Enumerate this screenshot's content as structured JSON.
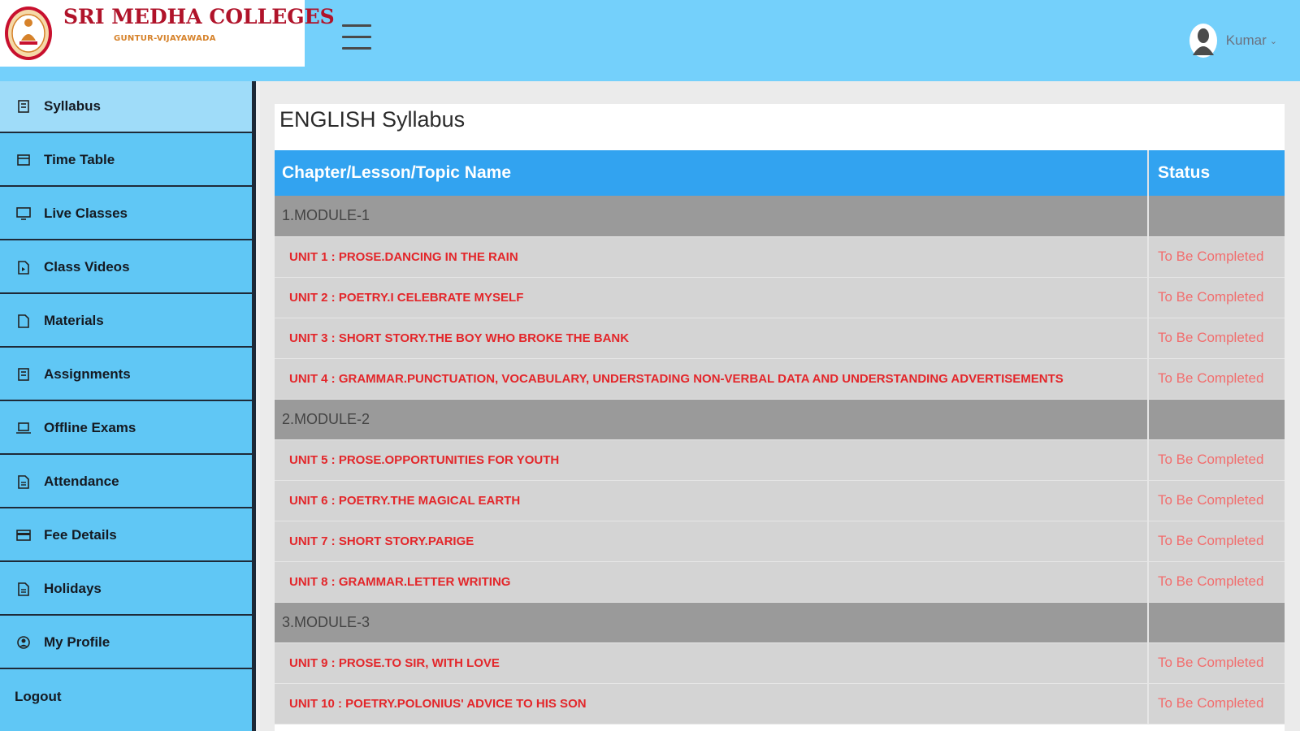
{
  "header": {
    "logo_title": "SRI MEDHA COLLEGES",
    "logo_subtitle": "GUNTUR-VIJAYAWADA",
    "user_name": "Kumar",
    "user_menu_chevron": "⌄",
    "menu_icon": "hamburger-icon"
  },
  "sidebar": {
    "items": [
      {
        "label": "Syllabus",
        "icon": "book-icon",
        "active": true
      },
      {
        "label": "Time Table",
        "icon": "calendar-icon"
      },
      {
        "label": "Live Classes",
        "icon": "monitor-icon"
      },
      {
        "label": "Class Videos",
        "icon": "file-video-icon"
      },
      {
        "label": "Materials",
        "icon": "document-icon"
      },
      {
        "label": "Assignments",
        "icon": "book-icon"
      },
      {
        "label": "Offline Exams",
        "icon": "laptop-icon"
      },
      {
        "label": "Attendance",
        "icon": "file-text-icon"
      },
      {
        "label": "Fee Details",
        "icon": "credit-card-icon"
      },
      {
        "label": "Holidays",
        "icon": "file-text-icon"
      },
      {
        "label": "My Profile",
        "icon": "user-circle-icon"
      },
      {
        "label": "Logout",
        "icon": ""
      }
    ]
  },
  "main": {
    "title": "ENGLISH Syllabus",
    "table": {
      "columns": [
        "Chapter/Lesson/Topic Name",
        "Status"
      ],
      "rows": [
        {
          "type": "module",
          "name": "1.MODULE-1",
          "status": ""
        },
        {
          "type": "unit",
          "name": "UNIT 1 : PROSE.DANCING IN THE RAIN",
          "status": "To Be Completed"
        },
        {
          "type": "unit",
          "name": "UNIT 2 : POETRY.I CELEBRATE MYSELF",
          "status": "To Be Completed"
        },
        {
          "type": "unit",
          "name": "UNIT 3 : SHORT STORY.THE BOY WHO BROKE THE BANK",
          "status": "To Be Completed"
        },
        {
          "type": "unit",
          "name": "UNIT 4 : GRAMMAR.PUNCTUATION, VOCABULARY, UNDERSTADING NON-VERBAL DATA AND UNDERSTANDING ADVERTISEMENTS",
          "status": "To Be Completed"
        },
        {
          "type": "module",
          "name": "2.MODULE-2",
          "status": ""
        },
        {
          "type": "unit",
          "name": "UNIT 5 : PROSE.OPPORTUNITIES FOR YOUTH",
          "status": "To Be Completed"
        },
        {
          "type": "unit",
          "name": "UNIT 6 : POETRY.THE MAGICAL EARTH",
          "status": "To Be Completed"
        },
        {
          "type": "unit",
          "name": "UNIT 7 : SHORT STORY.PARIGE",
          "status": "To Be Completed"
        },
        {
          "type": "unit",
          "name": "UNIT 8 : GRAMMAR.LETTER WRITING",
          "status": "To Be Completed"
        },
        {
          "type": "module",
          "name": "3.MODULE-3",
          "status": ""
        },
        {
          "type": "unit",
          "name": "UNIT 9 : PROSE.TO SIR, WITH LOVE",
          "status": "To Be Completed"
        },
        {
          "type": "unit",
          "name": "UNIT 10 : POETRY.POLONIUS' ADVICE TO HIS SON",
          "status": "To Be Completed"
        }
      ]
    }
  },
  "colors": {
    "topbar": "#74d0fb",
    "sidebar": "#60c7f5",
    "sidebar_active": "#9fdcf9",
    "table_header": "#32a3f0",
    "module_row": "#9a9a9a",
    "unit_row": "#d4d4d4",
    "topic_text": "#e3262a",
    "status_text": "#f26d6d",
    "logo_text": "#b0132a"
  }
}
